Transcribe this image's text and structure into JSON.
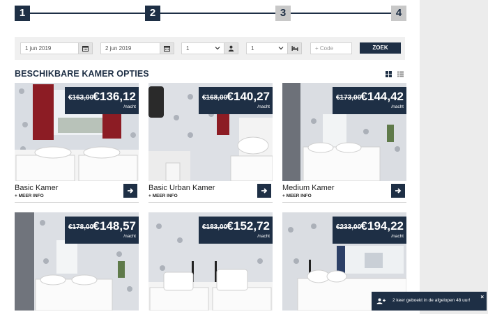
{
  "stepper": {
    "steps": [
      {
        "label": "1",
        "state": "done"
      },
      {
        "label": "2",
        "state": "done"
      },
      {
        "label": "3",
        "state": "todo"
      },
      {
        "label": "4",
        "state": "todo"
      }
    ]
  },
  "search": {
    "checkin": "1 jun 2019",
    "checkout": "2 jun 2019",
    "guests": "1",
    "rooms": "1",
    "code_placeholder": "+ Code",
    "submit_label": "ZOEK"
  },
  "heading": "BESCHIKBARE KAMER OPTIES",
  "price_unit": "/nacht",
  "more_info_label": "+ MEER INFO",
  "rooms": [
    {
      "name": "Basic Kamer",
      "old_price": "€163,00",
      "price": "€136,12"
    },
    {
      "name": "Basic Urban Kamer",
      "old_price": "€168,00",
      "price": "€140,27"
    },
    {
      "name": "Medium Kamer",
      "old_price": "€173,00",
      "price": "€144,42"
    },
    {
      "name": "",
      "old_price": "€178,00",
      "price": "€148,57"
    },
    {
      "name": "",
      "old_price": "€183,00",
      "price": "€152,72"
    },
    {
      "name": "",
      "old_price": "€233,00",
      "price": "€194,22"
    }
  ],
  "notification": {
    "text": "2 keer geboekt in de afgelopen 48 uur!",
    "close": "×"
  },
  "colors": {
    "brand": "#1e2f45",
    "step_inactive": "#c8c8c8",
    "curtain": "#8c1c24"
  }
}
